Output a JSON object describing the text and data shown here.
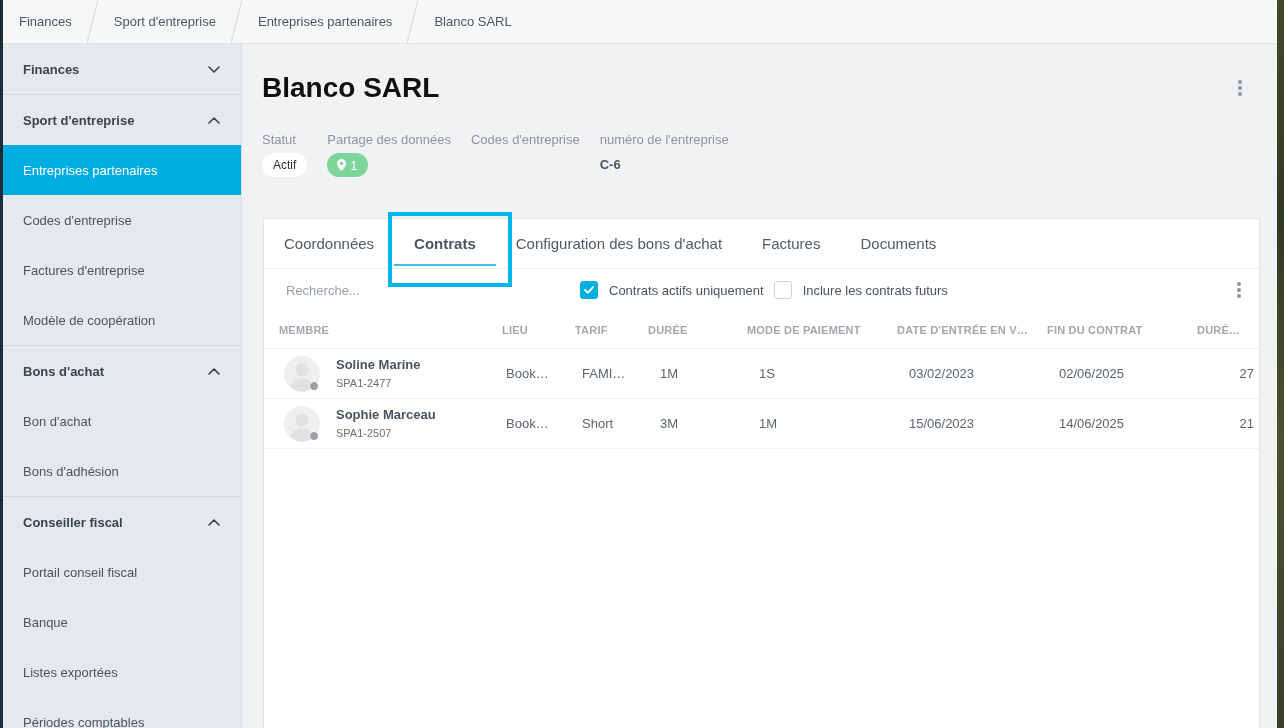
{
  "breadcrumbs": [
    "Finances",
    "Sport d'entreprise",
    "Entreprises partenaires",
    "Blanco SARL"
  ],
  "sidebar": {
    "groups": [
      {
        "title": "Finances",
        "expanded": false
      },
      {
        "title": "Sport d'entreprise",
        "expanded": true,
        "items": [
          {
            "label": "Entreprises partenaires",
            "selected": true
          },
          {
            "label": "Codes d'entreprise",
            "selected": false
          },
          {
            "label": "Factures d'entreprise",
            "selected": false
          },
          {
            "label": "Modèle de coopération",
            "selected": false
          }
        ]
      },
      {
        "title": "Bons d'achat",
        "expanded": true,
        "items": [
          {
            "label": "Bon d'achat",
            "selected": false
          },
          {
            "label": "Bons d'adhésion",
            "selected": false
          }
        ]
      },
      {
        "title": "Conseiller fiscal",
        "expanded": true,
        "items": [
          {
            "label": "Portail conseil fiscal",
            "selected": false
          },
          {
            "label": "Banque",
            "selected": false
          },
          {
            "label": "Listes exportées",
            "selected": false
          },
          {
            "label": "Périodes comptables",
            "selected": false
          }
        ]
      }
    ]
  },
  "page": {
    "title": "Blanco SARL",
    "fields": [
      {
        "label": "Statut",
        "kind": "pill",
        "value": "Actif"
      },
      {
        "label": "Partage des données",
        "kind": "location",
        "value": "1"
      },
      {
        "label": "Codes d'entreprise",
        "kind": "empty"
      },
      {
        "label": "numéro de l'entreprise",
        "kind": "text",
        "value": "C-6"
      }
    ]
  },
  "tabs": [
    {
      "label": "Coordonnées",
      "selected": false,
      "highlighted": false
    },
    {
      "label": "Contrats",
      "selected": true,
      "highlighted": true
    },
    {
      "label": "Configuration des bons d'achat",
      "selected": false,
      "highlighted": false
    },
    {
      "label": "Factures",
      "selected": false,
      "highlighted": false
    },
    {
      "label": "Documents",
      "selected": false,
      "highlighted": false
    }
  ],
  "toolbar": {
    "search": {
      "placeholder": "Recherche..."
    },
    "filters": [
      {
        "label": "Contrats actifs uniquement",
        "checked": true
      },
      {
        "label": "Inclure les contrats futurs",
        "checked": false
      }
    ]
  },
  "table": {
    "columns": [
      "MEMBRE",
      "LIEU",
      "TARIF",
      "DURÉE",
      "MODE DE PAIEMENT",
      "DATE D'ENTRÉE EN V…",
      "FIN DU CONTRAT",
      "DURÉ…"
    ],
    "rows": [
      {
        "cells": [
          {
            "name": "Soline Marine",
            "member_id": "SPA1-2477",
            "online": false
          },
          "Book…",
          "FAMI…",
          "1M",
          "1S",
          "03/02/2023",
          "02/06/2025",
          "27"
        ]
      },
      {
        "cells": [
          {
            "name": "Sophie Marceau",
            "member_id": "SPA1-2507",
            "online": false
          },
          "Book…",
          "Short",
          "3M",
          "1M",
          "15/06/2023",
          "14/06/2025",
          "21"
        ]
      }
    ]
  }
}
